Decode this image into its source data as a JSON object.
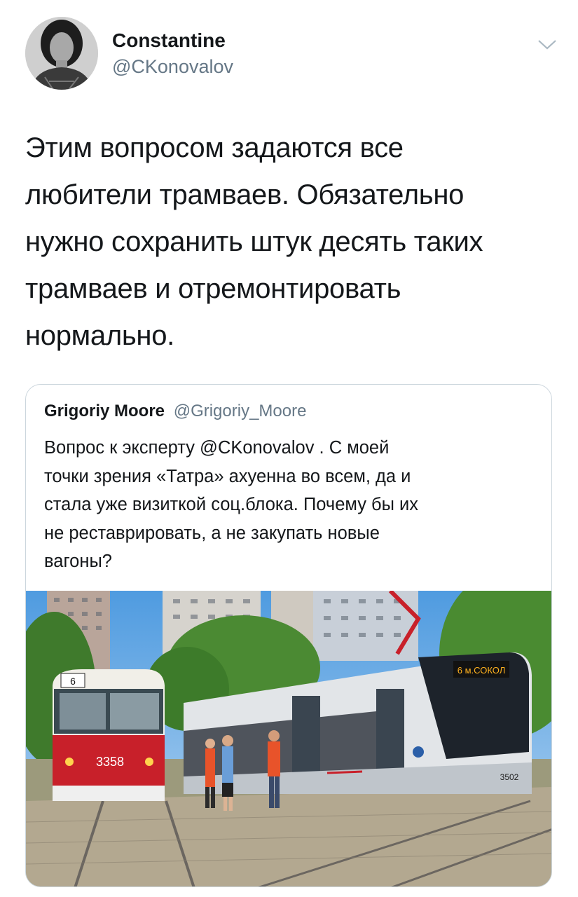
{
  "author": {
    "name": "Constantine",
    "handle": "@CKonovalov"
  },
  "tweet": {
    "lines": [
      "Этим вопросом задаются все",
      "любители трамваев. Обязательно",
      "нужно сохранить штук десять таких",
      "трамваев и отремонтировать",
      "нормально."
    ]
  },
  "quoted": {
    "name": "Grigoriy Moore",
    "handle": "@Grigoriy_Moore",
    "lines": [
      "Вопрос к эксперту @CKonovalov . С моей",
      "точки зрения «Татра» ахуенна во всем, да и",
      "стала уже визиткой соц.блока. Почему бы их",
      "не реставрировать, а не закупать новые",
      "вагоны?"
    ],
    "photo": {
      "old_tram_number": "3358",
      "old_tram_route": "6",
      "new_tram_number": "3502",
      "new_tram_sign": "6  м.СОКОЛ"
    }
  },
  "colors": {
    "text": "#14171a",
    "secondary": "#657786",
    "border": "#ccd6dd",
    "old_tram_red": "#c8202a",
    "new_tram_gray": "#d8dde2"
  }
}
